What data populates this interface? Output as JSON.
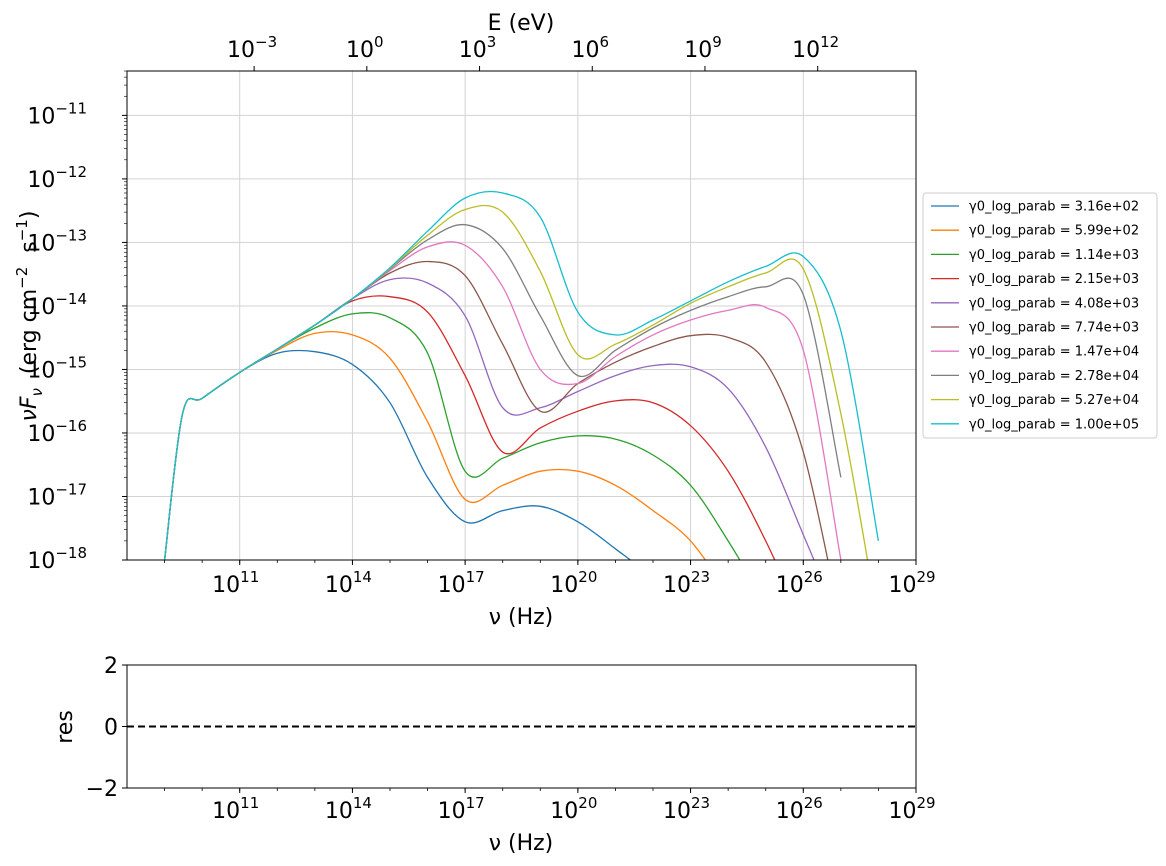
{
  "chart_data": [
    {
      "type": "line",
      "title": "",
      "xlabel": "ν  (Hz)",
      "ylabel": "νF_ν   (erg cm^-2  s^-1)",
      "ylabel_parts": {
        "nu": "ν",
        "F": "F",
        "sub": "ν",
        "units": "  (erg cm",
        "exp1": "−2",
        "s": "  s",
        "exp2": "−1",
        "close": ")"
      },
      "x_scale": "log",
      "y_scale": "log",
      "xlim": [
        100000000.0,
        1e+29
      ],
      "ylim": [
        1e-18,
        5e-11
      ],
      "grid": true,
      "legend_loc": "center-right-outside",
      "x_ticks": [
        {
          "value": 100000000000.0,
          "base": "10",
          "exp": "11"
        },
        {
          "value": 100000000000000.0,
          "base": "10",
          "exp": "14"
        },
        {
          "value": 1e+17,
          "base": "10",
          "exp": "17"
        },
        {
          "value": 1e+20,
          "base": "10",
          "exp": "20"
        },
        {
          "value": 1e+23,
          "base": "10",
          "exp": "23"
        },
        {
          "value": 1e+26,
          "base": "10",
          "exp": "26"
        },
        {
          "value": 1e+29,
          "base": "10",
          "exp": "29"
        }
      ],
      "y_ticks": [
        {
          "value": 1e-18,
          "base": "10",
          "exp": "−18"
        },
        {
          "value": 1e-17,
          "base": "10",
          "exp": "−17"
        },
        {
          "value": 1e-16,
          "base": "10",
          "exp": "−16"
        },
        {
          "value": 1e-15,
          "base": "10",
          "exp": "−15"
        },
        {
          "value": 1e-14,
          "base": "10",
          "exp": "−14"
        },
        {
          "value": 1e-13,
          "base": "10",
          "exp": "−13"
        },
        {
          "value": 1e-12,
          "base": "10",
          "exp": "−12"
        },
        {
          "value": 1e-11,
          "base": "10",
          "exp": "−11"
        }
      ],
      "top_axis": {
        "label": "E (eV)",
        "ticks": [
          {
            "value": 0.001,
            "base": "10",
            "exp": "−3"
          },
          {
            "value": 1.0,
            "base": "10",
            "exp": "0"
          },
          {
            "value": 1000.0,
            "base": "10",
            "exp": "3"
          },
          {
            "value": 1000000.0,
            "base": "10",
            "exp": "6"
          },
          {
            "value": 1000000000.0,
            "base": "10",
            "exp": "9"
          },
          {
            "value": 1000000000000.0,
            "base": "10",
            "exp": "12"
          }
        ]
      },
      "x": [
        1000000000.0,
        3000000000.0,
        10000000000.0,
        100000000000.0,
        1000000000000.0,
        10000000000000.0,
        100000000000000.0,
        1000000000000000.0,
        1e+16,
        1e+17,
        1e+18,
        1e+19,
        1e+20,
        1e+21,
        1e+22,
        1e+23,
        1e+24,
        1e+25,
        1e+26,
        1e+27,
        1e+28
      ],
      "series": [
        {
          "name": "γ0_log_parab = 3.16e+02",
          "color": "#1f77b4",
          "values": [
            1e-18,
            2e-16,
            3.5e-16,
            9e-16,
            1.8e-15,
            1.9e-15,
            1.2e-15,
            3e-16,
            2e-17,
            4e-18,
            6e-18,
            7e-18,
            4e-18,
            1.5e-18,
            5e-19,
            1e-19,
            null,
            null,
            null,
            null,
            null
          ]
        },
        {
          "name": "γ0_log_parab = 5.99e+02",
          "color": "#ff7f0e",
          "values": [
            1e-18,
            2e-16,
            3.5e-16,
            9e-16,
            2e-15,
            3.7e-15,
            3.5e-15,
            1.5e-15,
            1.5e-16,
            9e-18,
            1.5e-17,
            2.5e-17,
            2.5e-17,
            1.5e-17,
            6e-18,
            2e-18,
            3e-19,
            null,
            null,
            null,
            null
          ]
        },
        {
          "name": "γ0_log_parab = 1.14e+03",
          "color": "#2ca02c",
          "values": [
            1e-18,
            2e-16,
            3.5e-16,
            9e-16,
            2.1e-15,
            4.5e-15,
            7.5e-15,
            6.5e-15,
            1.8e-15,
            2.5e-17,
            4e-17,
            7e-17,
            9e-17,
            8e-17,
            4.5e-17,
            1.5e-17,
            2e-18,
            2e-19,
            null,
            null,
            null
          ]
        },
        {
          "name": "γ0_log_parab = 2.15e+03",
          "color": "#d62728",
          "values": [
            1e-18,
            2e-16,
            3.5e-16,
            9e-16,
            2.1e-15,
            5e-15,
            1.2e-14,
            1.4e-14,
            8e-15,
            8e-16,
            5e-17,
            1.2e-16,
            2.2e-16,
            3.2e-16,
            3e-16,
            1.3e-16,
            2.5e-17,
            2e-18,
            1e-19,
            null,
            null
          ]
        },
        {
          "name": "γ0_log_parab = 4.08e+03",
          "color": "#9467bd",
          "values": [
            1e-18,
            2e-16,
            3.5e-16,
            9e-16,
            2.1e-15,
            5e-15,
            1.3e-14,
            2.6e-14,
            2.3e-14,
            7e-15,
            2.5e-16,
            2.5e-16,
            4.5e-16,
            8e-16,
            1.15e-15,
            1.1e-15,
            5e-16,
            6e-17,
            2.5e-18,
            1e-19,
            null
          ]
        },
        {
          "name": "γ0_log_parab = 7.74e+03",
          "color": "#8c564b",
          "values": [
            1e-18,
            2e-16,
            3.5e-16,
            9e-16,
            2.1e-15,
            5e-15,
            1.3e-14,
            3.3e-14,
            5e-14,
            3e-14,
            2.5e-15,
            2.2e-16,
            6e-16,
            1.3e-15,
            2.3e-15,
            3.4e-15,
            3.2e-15,
            1.3e-15,
            5e-17,
            1e-19,
            null
          ]
        },
        {
          "name": "γ0_log_parab = 1.47e+04",
          "color": "#e377c2",
          "values": [
            1e-18,
            2e-16,
            3.5e-16,
            9e-16,
            2.1e-15,
            5e-15,
            1.3e-14,
            3.6e-14,
            8.5e-14,
            9e-14,
            2e-14,
            1e-15,
            6e-16,
            1.6e-15,
            3.5e-15,
            6e-15,
            8.5e-15,
            9.5e-15,
            2e-15,
            1e-18,
            null
          ]
        },
        {
          "name": "γ0_log_parab = 2.78e+04",
          "color": "#7f7f7f",
          "values": [
            1e-18,
            2e-16,
            3.5e-16,
            9e-16,
            2.1e-15,
            5e-15,
            1.3e-14,
            3.8e-14,
            1.1e-13,
            1.9e-13,
            8e-14,
            7e-15,
            8e-16,
            2e-15,
            4.5e-15,
            8.5e-15,
            1.4e-14,
            2e-14,
            1.5e-14,
            2e-17,
            null
          ]
        },
        {
          "name": "γ0_log_parab = 5.27e+04",
          "color": "#bcbd22",
          "values": [
            1e-18,
            2e-16,
            3.5e-16,
            9e-16,
            2.1e-15,
            5e-15,
            1.3e-14,
            3.9e-14,
            1.3e-13,
            3.3e-13,
            3e-13,
            3.5e-14,
            1.7e-15,
            2.5e-15,
            5e-15,
            1.1e-14,
            2e-14,
            3.3e-14,
            3.8e-14,
            2e-16,
            1e-19
          ]
        },
        {
          "name": "γ0_log_parab = 1.00e+05",
          "color": "#17becf",
          "values": [
            1e-18,
            2e-16,
            3.5e-16,
            9e-16,
            2.1e-15,
            5e-15,
            1.3e-14,
            4e-14,
            1.5e-13,
            5e-13,
            6e-13,
            2.5e-13,
            8e-15,
            3.5e-15,
            6e-15,
            1.2e-14,
            2.4e-14,
            4.2e-14,
            6e-14,
            4e-15,
            2e-18
          ]
        }
      ]
    },
    {
      "type": "line",
      "title": "",
      "xlabel": "ν  (Hz)",
      "ylabel": "res",
      "x_scale": "log",
      "xlim": [
        100000000.0,
        1e+29
      ],
      "ylim": [
        -2,
        2
      ],
      "grid": false,
      "y_ticks": [
        {
          "value": 2,
          "label": "2"
        },
        {
          "value": 0,
          "label": "0"
        },
        {
          "value": -2,
          "label": "−2"
        }
      ],
      "x_ticks": [
        {
          "value": 100000000000.0,
          "base": "10",
          "exp": "11"
        },
        {
          "value": 100000000000000.0,
          "base": "10",
          "exp": "14"
        },
        {
          "value": 1e+17,
          "base": "10",
          "exp": "17"
        },
        {
          "value": 1e+20,
          "base": "10",
          "exp": "20"
        },
        {
          "value": 1e+23,
          "base": "10",
          "exp": "23"
        },
        {
          "value": 1e+26,
          "base": "10",
          "exp": "26"
        },
        {
          "value": 1e+29,
          "base": "10",
          "exp": "29"
        }
      ],
      "reference_line": {
        "y": 0,
        "style": "dashed",
        "color": "#000000"
      }
    }
  ]
}
